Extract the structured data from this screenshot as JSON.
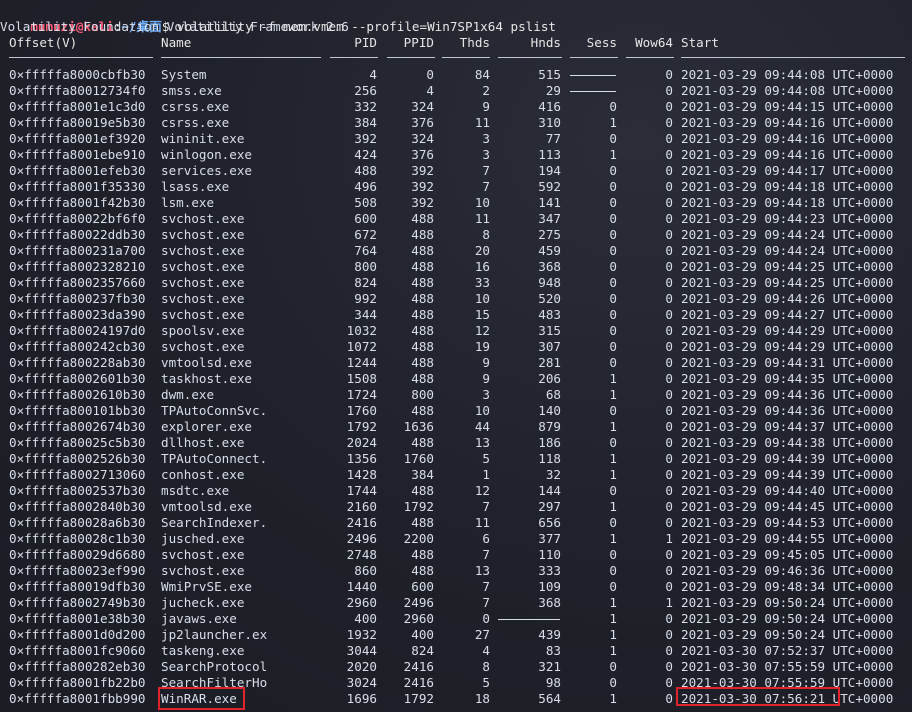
{
  "prompt": {
    "user_host": "mumuzi@kali",
    "separator": ":",
    "path": "~/桌面",
    "symbol": "$",
    "command": " volatility -f mem.vmem --profile=Win7SP1x64 pslist"
  },
  "banner": "Volatility Foundation Volatility Framework 2.6",
  "headers": {
    "offset": "Offset(V)",
    "name": "Name",
    "pid": "PID",
    "ppid": "PPID",
    "thds": "Thds",
    "hnds": "Hnds",
    "sess": "Sess",
    "wow64": "Wow64",
    "start": "Start"
  },
  "rows": [
    {
      "offset": "0×fffffa8000cbfb30",
      "name": "System",
      "pid": "4",
      "ppid": "0",
      "thds": "84",
      "hnds": "515",
      "sess": "",
      "wow64": "0",
      "start": "2021-03-29 09:44:08 UTC+0000"
    },
    {
      "offset": "0×fffffa80012734f0",
      "name": "smss.exe",
      "pid": "256",
      "ppid": "4",
      "thds": "2",
      "hnds": "29",
      "sess": "",
      "wow64": "0",
      "start": "2021-03-29 09:44:08 UTC+0000"
    },
    {
      "offset": "0×fffffa8001e1c3d0",
      "name": "csrss.exe",
      "pid": "332",
      "ppid": "324",
      "thds": "9",
      "hnds": "416",
      "sess": "0",
      "wow64": "0",
      "start": "2021-03-29 09:44:15 UTC+0000"
    },
    {
      "offset": "0×fffffa80019e5b30",
      "name": "csrss.exe",
      "pid": "384",
      "ppid": "376",
      "thds": "11",
      "hnds": "310",
      "sess": "1",
      "wow64": "0",
      "start": "2021-03-29 09:44:16 UTC+0000"
    },
    {
      "offset": "0×fffffa8001ef3920",
      "name": "wininit.exe",
      "pid": "392",
      "ppid": "324",
      "thds": "3",
      "hnds": "77",
      "sess": "0",
      "wow64": "0",
      "start": "2021-03-29 09:44:16 UTC+0000"
    },
    {
      "offset": "0×fffffa8001ebe910",
      "name": "winlogon.exe",
      "pid": "424",
      "ppid": "376",
      "thds": "3",
      "hnds": "113",
      "sess": "1",
      "wow64": "0",
      "start": "2021-03-29 09:44:16 UTC+0000"
    },
    {
      "offset": "0×fffffa8001efeb30",
      "name": "services.exe",
      "pid": "488",
      "ppid": "392",
      "thds": "7",
      "hnds": "194",
      "sess": "0",
      "wow64": "0",
      "start": "2021-03-29 09:44:17 UTC+0000"
    },
    {
      "offset": "0×fffffa8001f35330",
      "name": "lsass.exe",
      "pid": "496",
      "ppid": "392",
      "thds": "7",
      "hnds": "592",
      "sess": "0",
      "wow64": "0",
      "start": "2021-03-29 09:44:18 UTC+0000"
    },
    {
      "offset": "0×fffffa8001f42b30",
      "name": "lsm.exe",
      "pid": "508",
      "ppid": "392",
      "thds": "10",
      "hnds": "141",
      "sess": "0",
      "wow64": "0",
      "start": "2021-03-29 09:44:18 UTC+0000"
    },
    {
      "offset": "0×fffffa80022bf6f0",
      "name": "svchost.exe",
      "pid": "600",
      "ppid": "488",
      "thds": "11",
      "hnds": "347",
      "sess": "0",
      "wow64": "0",
      "start": "2021-03-29 09:44:23 UTC+0000"
    },
    {
      "offset": "0×fffffa80022ddb30",
      "name": "svchost.exe",
      "pid": "672",
      "ppid": "488",
      "thds": "8",
      "hnds": "275",
      "sess": "0",
      "wow64": "0",
      "start": "2021-03-29 09:44:24 UTC+0000"
    },
    {
      "offset": "0×fffffa800231a700",
      "name": "svchost.exe",
      "pid": "764",
      "ppid": "488",
      "thds": "20",
      "hnds": "459",
      "sess": "0",
      "wow64": "0",
      "start": "2021-03-29 09:44:24 UTC+0000"
    },
    {
      "offset": "0×fffffa8002328210",
      "name": "svchost.exe",
      "pid": "800",
      "ppid": "488",
      "thds": "16",
      "hnds": "368",
      "sess": "0",
      "wow64": "0",
      "start": "2021-03-29 09:44:25 UTC+0000"
    },
    {
      "offset": "0×fffffa8002357660",
      "name": "svchost.exe",
      "pid": "824",
      "ppid": "488",
      "thds": "33",
      "hnds": "948",
      "sess": "0",
      "wow64": "0",
      "start": "2021-03-29 09:44:25 UTC+0000"
    },
    {
      "offset": "0×fffffa800237fb30",
      "name": "svchost.exe",
      "pid": "992",
      "ppid": "488",
      "thds": "10",
      "hnds": "520",
      "sess": "0",
      "wow64": "0",
      "start": "2021-03-29 09:44:26 UTC+0000"
    },
    {
      "offset": "0×fffffa80023da390",
      "name": "svchost.exe",
      "pid": "344",
      "ppid": "488",
      "thds": "15",
      "hnds": "483",
      "sess": "0",
      "wow64": "0",
      "start": "2021-03-29 09:44:27 UTC+0000"
    },
    {
      "offset": "0×fffffa80024197d0",
      "name": "spoolsv.exe",
      "pid": "1032",
      "ppid": "488",
      "thds": "12",
      "hnds": "315",
      "sess": "0",
      "wow64": "0",
      "start": "2021-03-29 09:44:29 UTC+0000"
    },
    {
      "offset": "0×fffffa800242cb30",
      "name": "svchost.exe",
      "pid": "1072",
      "ppid": "488",
      "thds": "19",
      "hnds": "307",
      "sess": "0",
      "wow64": "0",
      "start": "2021-03-29 09:44:29 UTC+0000"
    },
    {
      "offset": "0×fffffa800228ab30",
      "name": "vmtoolsd.exe",
      "pid": "1244",
      "ppid": "488",
      "thds": "9",
      "hnds": "281",
      "sess": "0",
      "wow64": "0",
      "start": "2021-03-29 09:44:31 UTC+0000"
    },
    {
      "offset": "0×fffffa8002601b30",
      "name": "taskhost.exe",
      "pid": "1508",
      "ppid": "488",
      "thds": "9",
      "hnds": "206",
      "sess": "1",
      "wow64": "0",
      "start": "2021-03-29 09:44:35 UTC+0000"
    },
    {
      "offset": "0×fffffa8002610b30",
      "name": "dwm.exe",
      "pid": "1724",
      "ppid": "800",
      "thds": "3",
      "hnds": "68",
      "sess": "1",
      "wow64": "0",
      "start": "2021-03-29 09:44:36 UTC+0000"
    },
    {
      "offset": "0×fffffa800101bb30",
      "name": "TPAutoConnSvc.",
      "pid": "1760",
      "ppid": "488",
      "thds": "10",
      "hnds": "140",
      "sess": "0",
      "wow64": "0",
      "start": "2021-03-29 09:44:36 UTC+0000"
    },
    {
      "offset": "0×fffffa8002674b30",
      "name": "explorer.exe",
      "pid": "1792",
      "ppid": "1636",
      "thds": "44",
      "hnds": "879",
      "sess": "1",
      "wow64": "0",
      "start": "2021-03-29 09:44:37 UTC+0000"
    },
    {
      "offset": "0×fffffa80025c5b30",
      "name": "dllhost.exe",
      "pid": "2024",
      "ppid": "488",
      "thds": "13",
      "hnds": "186",
      "sess": "0",
      "wow64": "0",
      "start": "2021-03-29 09:44:38 UTC+0000"
    },
    {
      "offset": "0×fffffa8002526b30",
      "name": "TPAutoConnect.",
      "pid": "1356",
      "ppid": "1760",
      "thds": "5",
      "hnds": "118",
      "sess": "1",
      "wow64": "0",
      "start": "2021-03-29 09:44:39 UTC+0000"
    },
    {
      "offset": "0×fffffa8002713060",
      "name": "conhost.exe",
      "pid": "1428",
      "ppid": "384",
      "thds": "1",
      "hnds": "32",
      "sess": "1",
      "wow64": "0",
      "start": "2021-03-29 09:44:39 UTC+0000"
    },
    {
      "offset": "0×fffffa8002537b30",
      "name": "msdtc.exe",
      "pid": "1744",
      "ppid": "488",
      "thds": "12",
      "hnds": "144",
      "sess": "0",
      "wow64": "0",
      "start": "2021-03-29 09:44:40 UTC+0000"
    },
    {
      "offset": "0×fffffa8002840b30",
      "name": "vmtoolsd.exe",
      "pid": "2160",
      "ppid": "1792",
      "thds": "7",
      "hnds": "297",
      "sess": "1",
      "wow64": "0",
      "start": "2021-03-29 09:44:45 UTC+0000"
    },
    {
      "offset": "0×fffffa80028a6b30",
      "name": "SearchIndexer.",
      "pid": "2416",
      "ppid": "488",
      "thds": "11",
      "hnds": "656",
      "sess": "0",
      "wow64": "0",
      "start": "2021-03-29 09:44:53 UTC+0000"
    },
    {
      "offset": "0×fffffa80028c1b30",
      "name": "jusched.exe",
      "pid": "2496",
      "ppid": "2200",
      "thds": "6",
      "hnds": "377",
      "sess": "1",
      "wow64": "1",
      "start": "2021-03-29 09:44:55 UTC+0000"
    },
    {
      "offset": "0×fffffa80029d6680",
      "name": "svchost.exe",
      "pid": "2748",
      "ppid": "488",
      "thds": "7",
      "hnds": "110",
      "sess": "0",
      "wow64": "0",
      "start": "2021-03-29 09:45:05 UTC+0000"
    },
    {
      "offset": "0×fffffa80023ef990",
      "name": "svchost.exe",
      "pid": "860",
      "ppid": "488",
      "thds": "13",
      "hnds": "333",
      "sess": "0",
      "wow64": "0",
      "start": "2021-03-29 09:46:36 UTC+0000"
    },
    {
      "offset": "0×fffffa80019dfb30",
      "name": "WmiPrvSE.exe",
      "pid": "1440",
      "ppid": "600",
      "thds": "7",
      "hnds": "109",
      "sess": "0",
      "wow64": "0",
      "start": "2021-03-29 09:48:34 UTC+0000"
    },
    {
      "offset": "0×fffffa8002749b30",
      "name": "jucheck.exe",
      "pid": "2960",
      "ppid": "2496",
      "thds": "7",
      "hnds": "368",
      "sess": "1",
      "wow64": "1",
      "start": "2021-03-29 09:50:24 UTC+0000"
    },
    {
      "offset": "0×fffffa8001e38b30",
      "name": "javaws.exe",
      "pid": "400",
      "ppid": "2960",
      "thds": "0",
      "hnds": "",
      "sess": "1",
      "wow64": "0",
      "start": "2021-03-29 09:50:24 UTC+0000"
    },
    {
      "offset": "0×fffffa8001d0d200",
      "name": "jp2launcher.ex",
      "pid": "1932",
      "ppid": "400",
      "thds": "27",
      "hnds": "439",
      "sess": "1",
      "wow64": "0",
      "start": "2021-03-29 09:50:24 UTC+0000"
    },
    {
      "offset": "0×fffffa8001fc9060",
      "name": "taskeng.exe",
      "pid": "3044",
      "ppid": "824",
      "thds": "4",
      "hnds": "83",
      "sess": "1",
      "wow64": "0",
      "start": "2021-03-30 07:52:37 UTC+0000"
    },
    {
      "offset": "0×fffffa800282eb30",
      "name": "SearchProtocol",
      "pid": "2020",
      "ppid": "2416",
      "thds": "8",
      "hnds": "321",
      "sess": "0",
      "wow64": "0",
      "start": "2021-03-30 07:55:59 UTC+0000"
    },
    {
      "offset": "0×fffffa8001fb22b0",
      "name": "SearchFilterHo",
      "pid": "3024",
      "ppid": "2416",
      "thds": "5",
      "hnds": "98",
      "sess": "0",
      "wow64": "0",
      "start": "2021-03-30 07:55:59 UTC+0000"
    },
    {
      "offset": "0×fffffa8001fbb990",
      "name": "WinRAR.exe",
      "pid": "1696",
      "ppid": "1792",
      "thds": "18",
      "hnds": "564",
      "sess": "1",
      "wow64": "0",
      "start": "2021-03-30 07:56:21 UTC+0000",
      "start_date": "2021-03-30 07:56:21",
      "start_tz": "UTC+0000"
    }
  ],
  "highlight_color": "#e0242c",
  "prompt_user_color": "#ff5c7a",
  "prompt_path_color": "#6fb1ff",
  "background_color": "#1e1f29"
}
